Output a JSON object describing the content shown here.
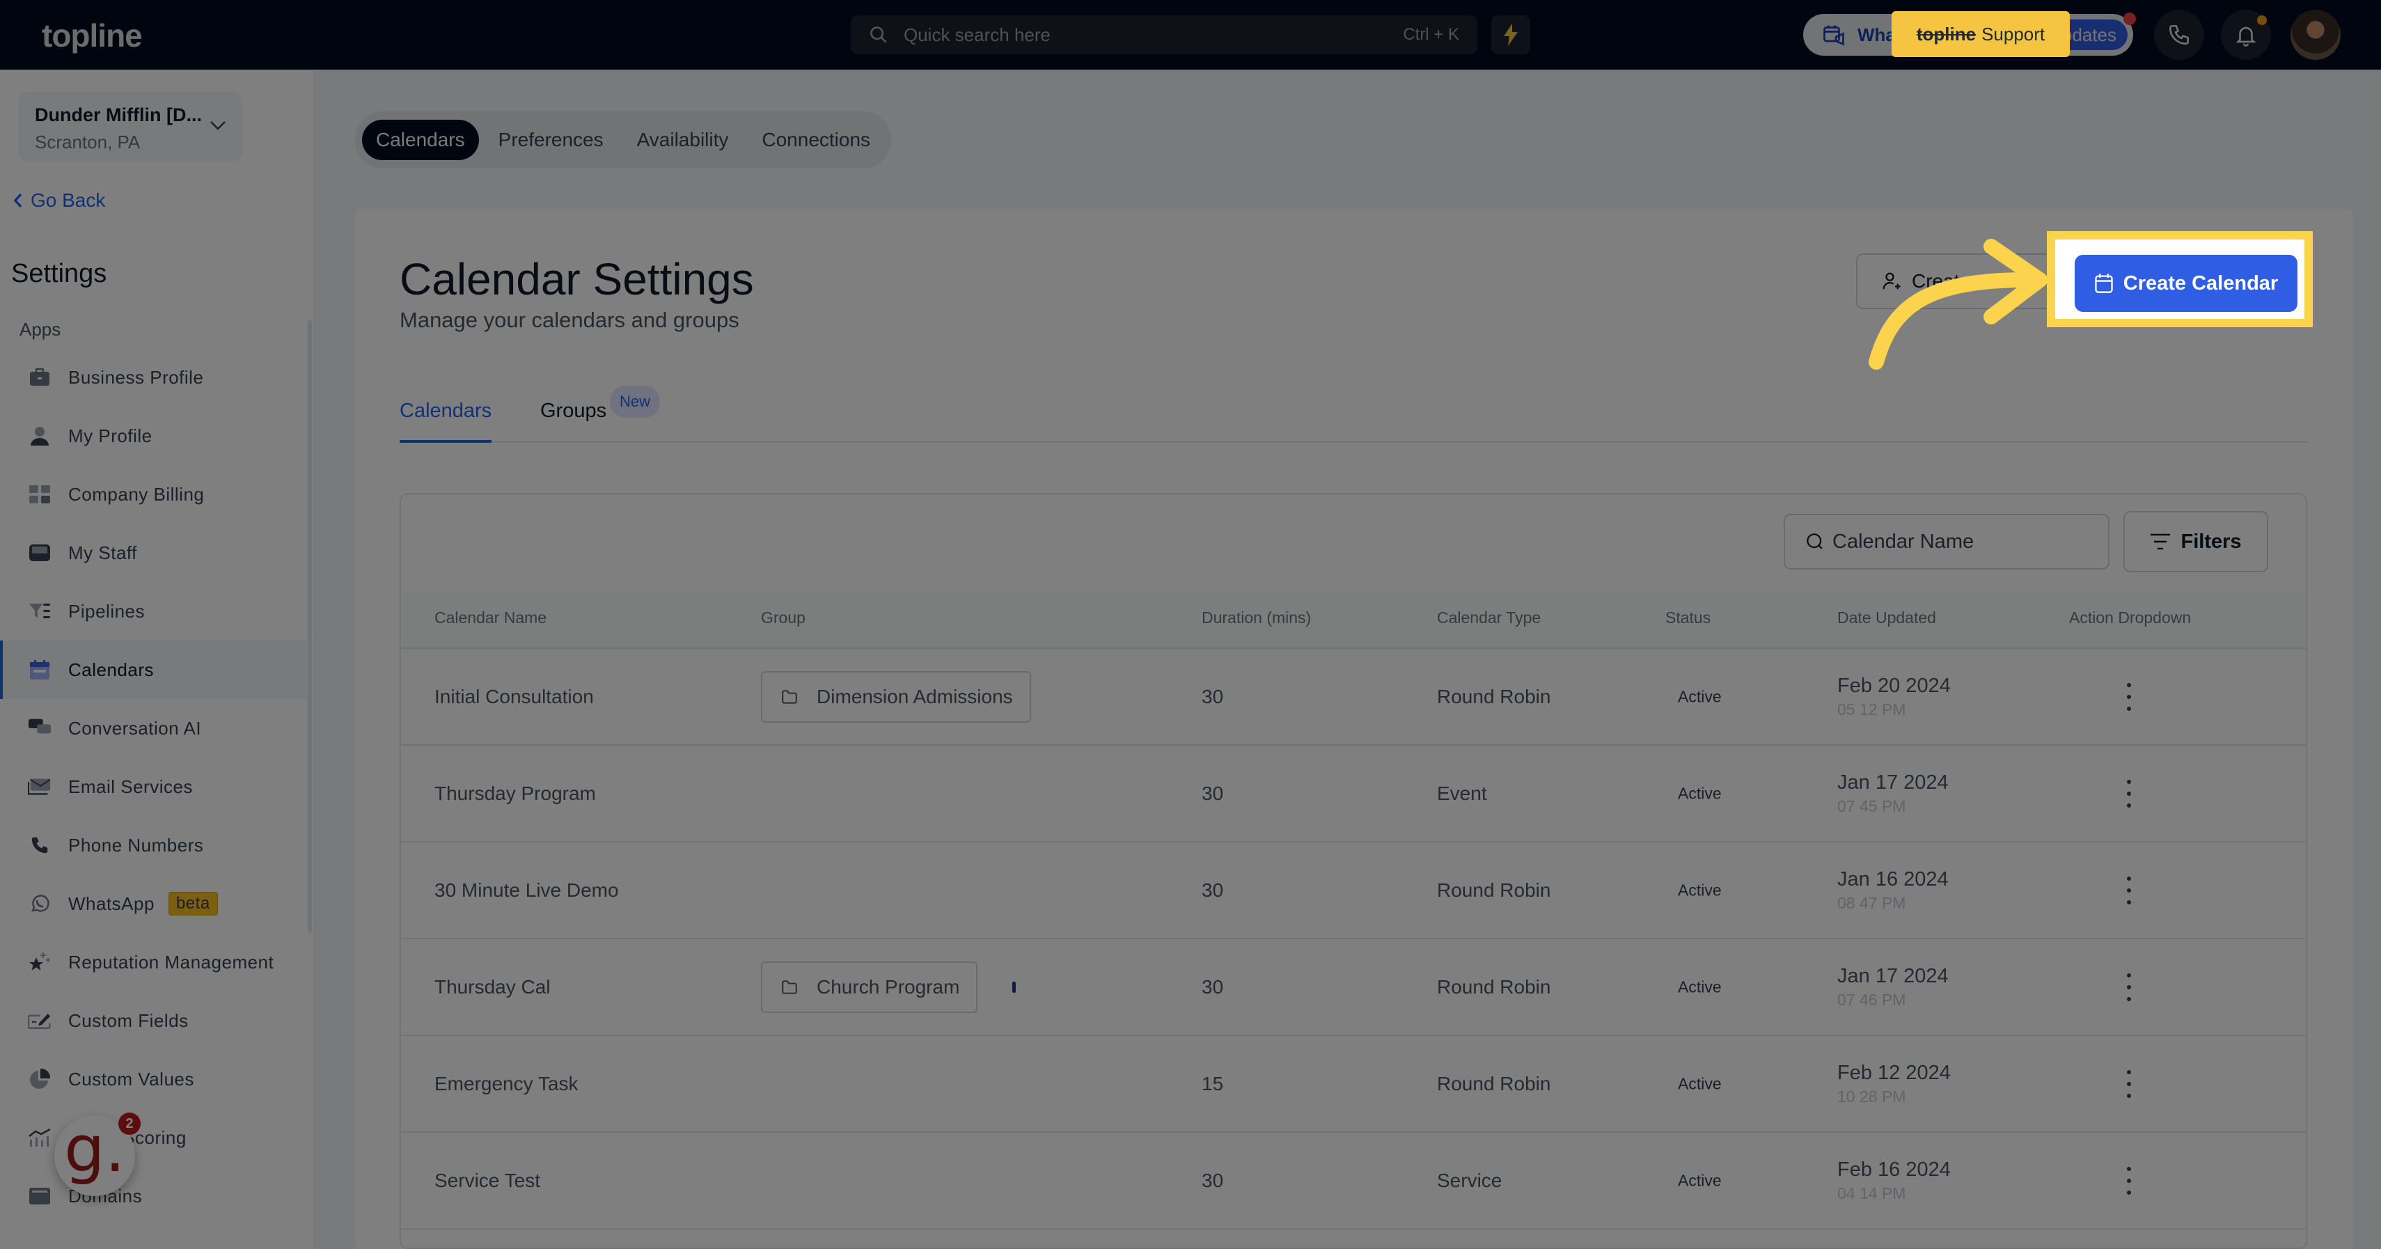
{
  "app": {
    "logo": "topline"
  },
  "topbar": {
    "search_placeholder": "Quick search here",
    "search_shortcut": "Ctrl + K",
    "whats_new_label": "What's New",
    "updates_label": "Updates",
    "support_tooltip_brand": "topline",
    "support_tooltip_label": "Support",
    "icons": [
      "search-icon",
      "bolt-icon",
      "megaphone-calendar-icon",
      "phone-icon",
      "bell-icon",
      "avatar"
    ]
  },
  "sidebar": {
    "location_name": "Dunder Mifflin [D...",
    "location_city": "Scranton, PA",
    "go_back": "Go Back",
    "heading": "Settings",
    "section": "Apps",
    "items": [
      {
        "label": "Business Profile",
        "icon": "briefcase-icon"
      },
      {
        "label": "My Profile",
        "icon": "user-icon"
      },
      {
        "label": "Company Billing",
        "icon": "calculator-icon"
      },
      {
        "label": "My Staff",
        "icon": "inbox-icon"
      },
      {
        "label": "Pipelines",
        "icon": "filter-list-icon"
      },
      {
        "label": "Calendars",
        "icon": "calendar-icon",
        "active": true
      },
      {
        "label": "Conversation AI",
        "icon": "chat-bubbles-icon"
      },
      {
        "label": "Email Services",
        "icon": "mail-icon"
      },
      {
        "label": "Phone Numbers",
        "icon": "phone-icon"
      },
      {
        "label": "WhatsApp",
        "icon": "whatsapp-icon",
        "badge": "beta"
      },
      {
        "label": "Reputation Management",
        "icon": "star-sparkle-icon"
      },
      {
        "label": "Custom Fields",
        "icon": "edit-field-icon"
      },
      {
        "label": "Custom Values",
        "icon": "pie-chart-icon"
      },
      {
        "label": "Score Scoring",
        "icon": "chart-icon"
      },
      {
        "label": "Domains",
        "icon": "browser-window-icon"
      }
    ],
    "g_widget_badge": "2"
  },
  "main": {
    "top_tabs": [
      {
        "label": "Calendars",
        "active": true
      },
      {
        "label": "Preferences"
      },
      {
        "label": "Availability"
      },
      {
        "label": "Connections"
      }
    ],
    "title": "Calendar Settings",
    "subtitle": "Manage your calendars and groups",
    "create_group_label": "Create Group",
    "create_calendar_label": "Create Calendar",
    "sub_tabs": [
      {
        "label": "Calendars",
        "active": true
      },
      {
        "label": "Groups",
        "badge": "New"
      }
    ],
    "table": {
      "search_placeholder": "Calendar Name",
      "filters_label": "Filters",
      "columns": [
        "Calendar Name",
        "Group",
        "Duration (mins)",
        "Calendar Type",
        "Status",
        "Date Updated",
        "Action Dropdown"
      ],
      "rows": [
        {
          "name": "Initial Consultation",
          "group": "Dimension Admissions",
          "duration": "30",
          "type": "Round Robin",
          "status": "Active",
          "date": "Feb 20 2024",
          "time": "05 12 PM"
        },
        {
          "name": "Thursday Program",
          "group": "",
          "duration": "30",
          "type": "Event",
          "status": "Active",
          "date": "Jan 17 2024",
          "time": "07 45 PM"
        },
        {
          "name": "30 Minute Live Demo",
          "group": "",
          "duration": "30",
          "type": "Round Robin",
          "status": "Active",
          "date": "Jan 16 2024",
          "time": "08 47 PM"
        },
        {
          "name": "Thursday Cal",
          "group": "Church Program",
          "duration": "30",
          "type": "Round Robin",
          "status": "Active",
          "date": "Jan 17 2024",
          "time": "07 46 PM"
        },
        {
          "name": "Emergency Task",
          "group": "",
          "duration": "15",
          "type": "Round Robin",
          "status": "Active",
          "date": "Feb 12 2024",
          "time": "10 28 PM"
        },
        {
          "name": "Service Test",
          "group": "",
          "duration": "30",
          "type": "Service",
          "status": "Active",
          "date": "Feb 16 2024",
          "time": "04 14 PM"
        }
      ]
    }
  },
  "colors": {
    "accent": "#2f5ee5",
    "highlight": "#fcd34d",
    "topbar": "#020a1f"
  }
}
